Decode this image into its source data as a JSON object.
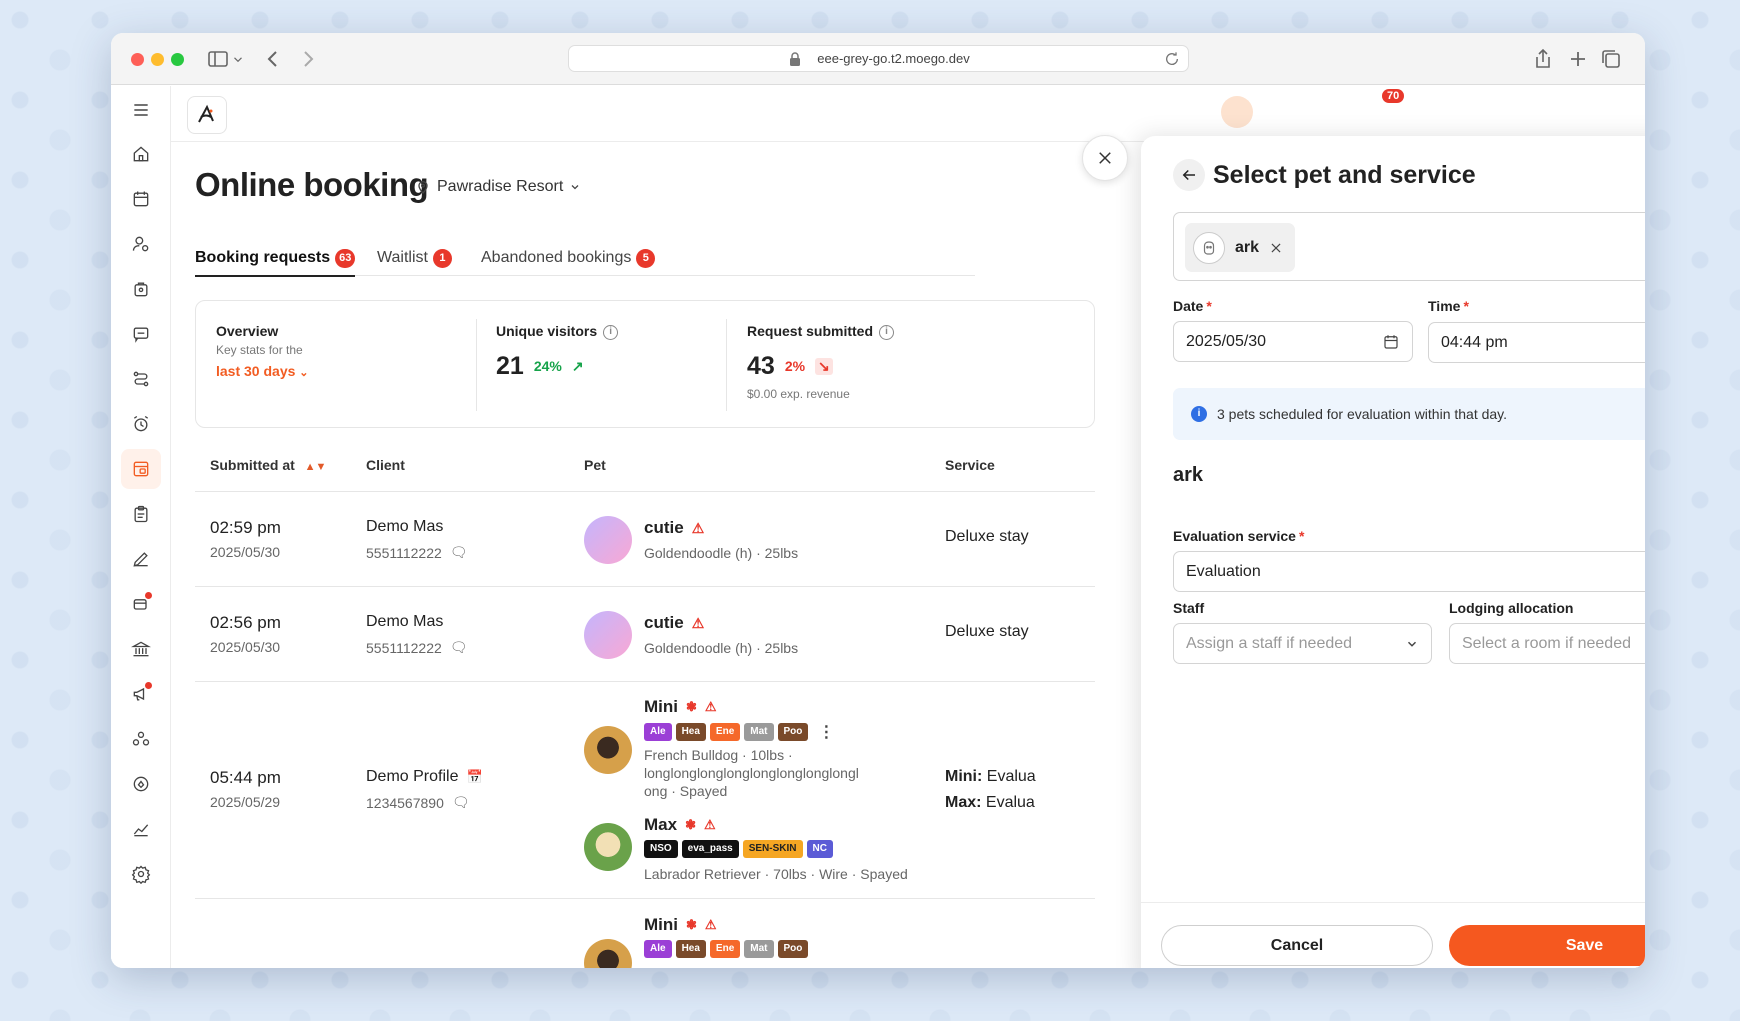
{
  "browser": {
    "url": "eee-grey-go.t2.moego.dev"
  },
  "page": {
    "title": "Online booking",
    "location": "Pawradise Resort"
  },
  "tabs": [
    {
      "label": "Booking requests",
      "badge": "63"
    },
    {
      "label": "Waitlist",
      "badge": "1"
    },
    {
      "label": "Abandoned bookings",
      "badge": "5"
    }
  ],
  "notification_count": "70",
  "stats": {
    "overview_title": "Overview",
    "overview_sub": "Key stats for the",
    "overview_range": "last 30 days",
    "unique_visitors_label": "Unique visitors",
    "unique_visitors_value": "21",
    "unique_visitors_pct": "24%",
    "requests_label": "Request submitted",
    "requests_value": "43",
    "requests_pct": "2%",
    "requests_revenue": "$0.00 exp. revenue"
  },
  "table": {
    "headers": {
      "submitted": "Submitted at",
      "client": "Client",
      "pet": "Pet",
      "service": "Service"
    },
    "rows": [
      {
        "time": "02:59 pm",
        "date": "2025/05/30",
        "client": "Demo Mas",
        "phone": "5551112222",
        "pet_name": "cutie",
        "pet_meta": "Goldendoodle (h) · 25lbs",
        "service": "Deluxe stay"
      },
      {
        "time": "02:56 pm",
        "date": "2025/05/30",
        "client": "Demo Mas",
        "phone": "5551112222",
        "pet_name": "cutie",
        "pet_meta": "Goldendoodle (h) · 25lbs",
        "service": "Deluxe stay"
      },
      {
        "time": "05:44 pm",
        "date": "2025/05/29",
        "client": "Demo Profile",
        "phone": "1234567890",
        "pets": [
          {
            "name": "Mini",
            "tags": [
              "Ale",
              "Hea",
              "Ene",
              "Mat",
              "Poo"
            ],
            "meta_line1": "French Bulldog · 10lbs ·",
            "meta_line2": "longlonglonglonglonglonglonglongl",
            "meta_line3": "ong · Spayed"
          },
          {
            "name": "Max",
            "tags": [
              "NSO",
              "eva_pass",
              "SEN-SKIN",
              "NC"
            ],
            "meta_line1": "Labrador Retriever · 70lbs · Wire · Spayed"
          }
        ],
        "service_line1_label": "Mini:",
        "service_line1": "Evalua",
        "service_line2_label": "Max:",
        "service_line2": "Evalua"
      },
      {
        "pet_name": "Mini",
        "tags": [
          "Ale",
          "Hea",
          "Ene",
          "Mat",
          "Poo"
        ]
      }
    ]
  },
  "tag_colors": {
    "Ale": "#9b3fd6",
    "Hea": "#7a4a2a",
    "Ene": "#f5682a",
    "Mat": "#9a9a9a",
    "Poo": "#7a4a2a",
    "NSO": "#111111",
    "eva_pass": "#111111",
    "SEN-SKIN": "#f5a623",
    "NC": "#5b5bd6"
  },
  "drawer": {
    "title": "Select pet and service",
    "selected_pet": "ark",
    "date_label": "Date",
    "date_value": "2025/05/30",
    "time_label": "Time",
    "time_value": "04:44 pm",
    "alert": "3 pets scheduled for evaluation within that day.",
    "section_title": "ark",
    "eval_label": "Evaluation service",
    "eval_value": "Evaluation",
    "staff_label": "Staff",
    "staff_placeholder": "Assign a staff if needed",
    "lodging_label": "Lodging allocation",
    "lodging_placeholder": "Select a room if needed",
    "cancel": "Cancel",
    "save": "Save"
  },
  "colors": {
    "accent": "#f5581f",
    "badge": "#e8382b",
    "info": "#2f6fe4"
  }
}
